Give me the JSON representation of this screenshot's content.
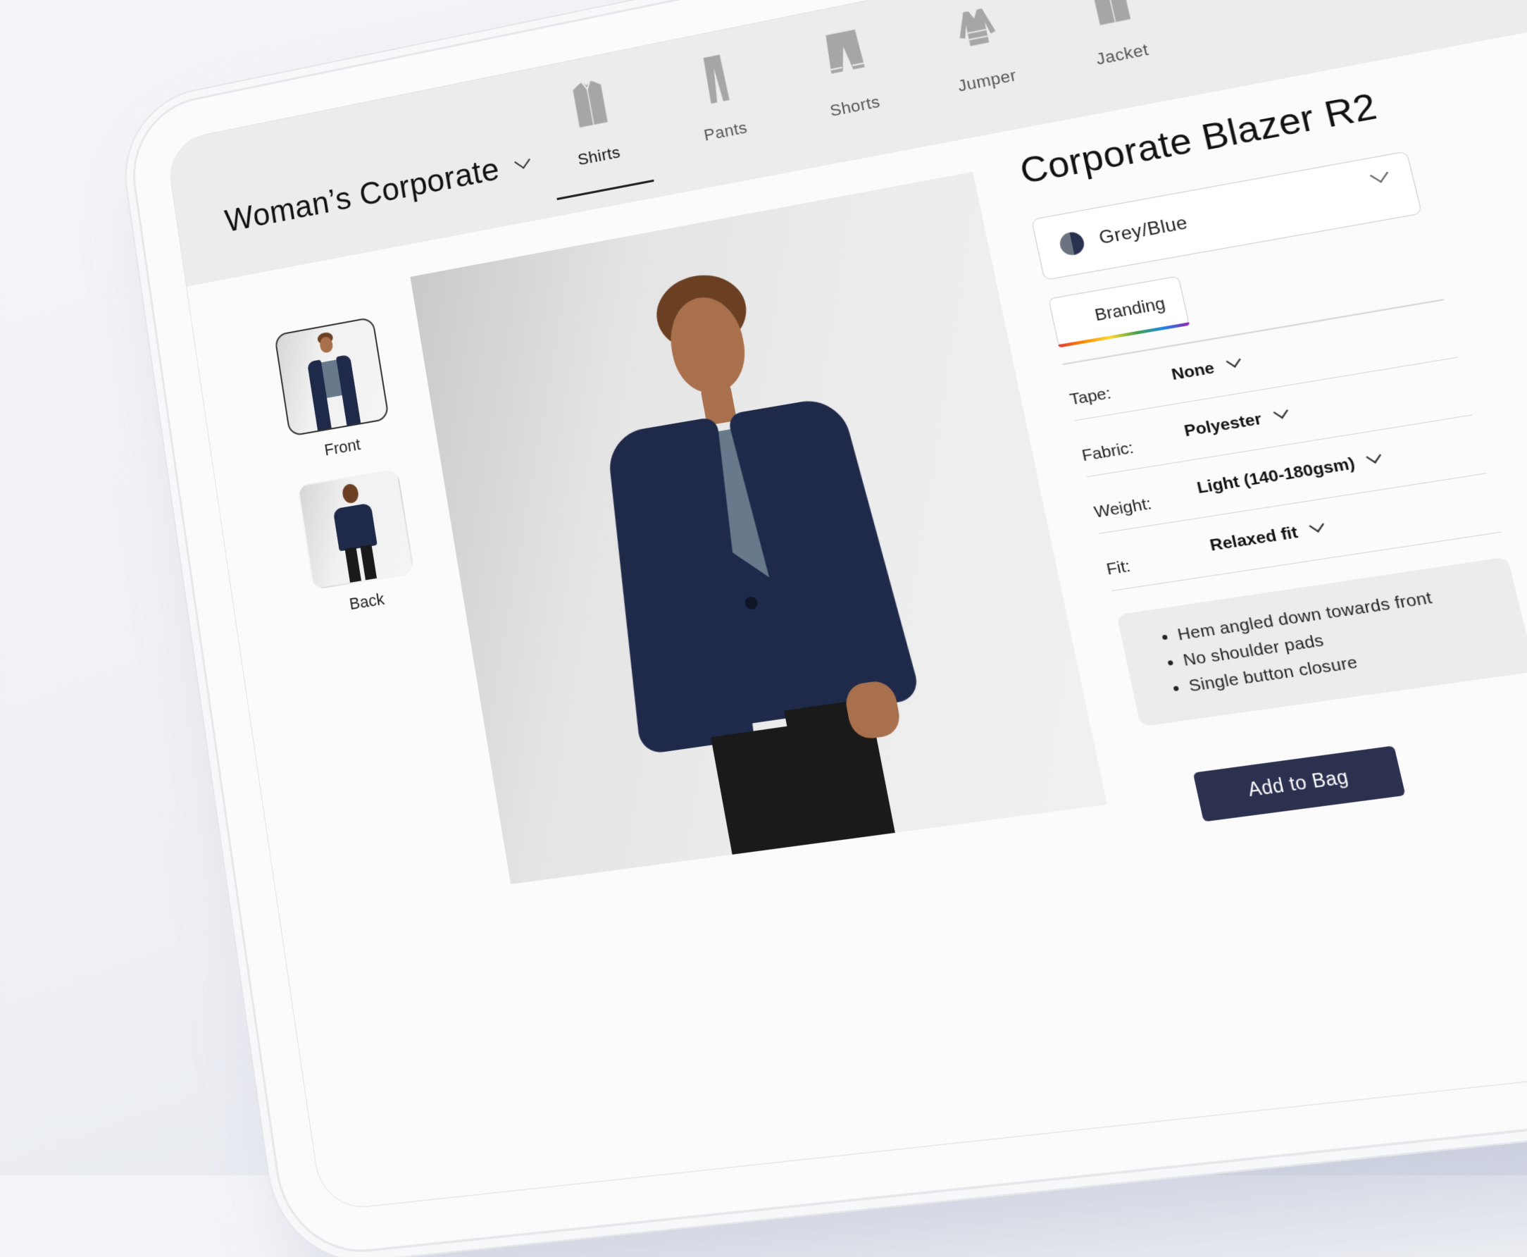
{
  "header": {
    "collection": {
      "label": "Woman’s Corporate",
      "icon": "chevron-down-icon"
    },
    "categories": [
      {
        "label": "Shirts",
        "icon": "shirt-icon",
        "active": true
      },
      {
        "label": "Pants",
        "icon": "pants-icon",
        "active": false
      },
      {
        "label": "Shorts",
        "icon": "shorts-icon",
        "active": false
      },
      {
        "label": "Jumper",
        "icon": "jumper-icon",
        "active": false
      },
      {
        "label": "Jacket",
        "icon": "jacket-icon",
        "active": false
      }
    ]
  },
  "gallery": {
    "thumbnails": [
      {
        "label": "Front",
        "selected": true
      },
      {
        "label": "Back",
        "selected": false
      }
    ],
    "hero_alt": "Model wearing navy blazer over grey top, front view"
  },
  "product": {
    "title": "Corporate Blazer R2",
    "colour": {
      "label": "Grey/Blue",
      "swatch": [
        "#6b7280",
        "#2b3151"
      ]
    },
    "branding_label": "Branding",
    "options": [
      {
        "label": "Tape:",
        "value": "None"
      },
      {
        "label": "Fabric:",
        "value": "Polyester"
      },
      {
        "label": "Weight:",
        "value": "Light (140-180gsm)"
      },
      {
        "label": "Fit:",
        "value": "Relaxed fit"
      }
    ],
    "features": [
      "Hem angled down towards front",
      "No shoulder pads",
      "Single button closure"
    ],
    "add_to_bag_label": "Add to Bag"
  },
  "colors": {
    "accent": "#2c3150",
    "nav_bg": "#ececec",
    "feature_bg": "#ececec",
    "jacket": "#1f2a4a",
    "top": "#67798a"
  }
}
